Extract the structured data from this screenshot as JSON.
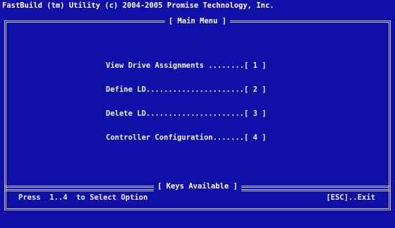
{
  "header": {
    "title": "FastBuild (tm) Utility (c) 2004-2005 Promise Technology, Inc."
  },
  "main_menu": {
    "title": "[ Main Menu ]",
    "items": [
      {
        "label": "View Drive Assignments ........[ 1 ]"
      },
      {
        "label": "Define LD......................[ 2 ]"
      },
      {
        "label": "Delete LD......................[ 3 ]"
      },
      {
        "label": "Controller Configuration.......[ 4 ]"
      }
    ]
  },
  "keys_available": {
    "title": "[ Keys Available ]",
    "left_hint": "Press  1..4  to Select Option",
    "right_hint": "[ESC]..Exit"
  }
}
